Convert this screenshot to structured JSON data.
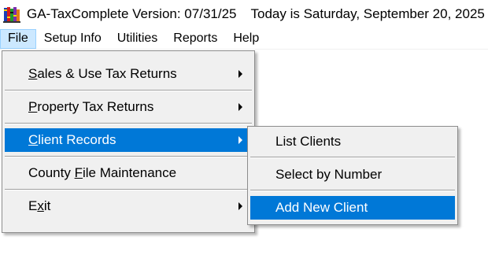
{
  "window": {
    "title": "GA-TaxComplete Version: 07/31/25",
    "date_text": "Today is Saturday, September 20, 2025"
  },
  "menubar": {
    "items": [
      "File",
      "Setup Info",
      "Utilities",
      "Reports",
      "Help"
    ],
    "open_menu": "File"
  },
  "file_menu": {
    "items": [
      {
        "pre": "",
        "key": "S",
        "post": "ales & Use Tax Returns",
        "submenu": true
      },
      {
        "pre": "",
        "key": "P",
        "post": "roperty Tax Returns",
        "submenu": true
      },
      {
        "pre": "",
        "key": "C",
        "post": "lient Records",
        "submenu": true,
        "selected": true
      },
      {
        "pre": "County ",
        "key": "F",
        "post": "ile Maintenance",
        "submenu": false
      },
      {
        "pre": "E",
        "key": "x",
        "post": "it",
        "submenu": true
      }
    ]
  },
  "client_records_menu": {
    "items": [
      {
        "label": "List Clients"
      },
      {
        "label": "Select by Number"
      },
      {
        "label": "Add New Client",
        "selected": true
      }
    ]
  },
  "colors": {
    "highlight": "#0078d7",
    "menu_bg": "#f0f0f0",
    "menubar_open": "#cce8ff"
  },
  "icons": {
    "app": "books-stack-icon",
    "submenu": "submenu-arrow-icon"
  }
}
